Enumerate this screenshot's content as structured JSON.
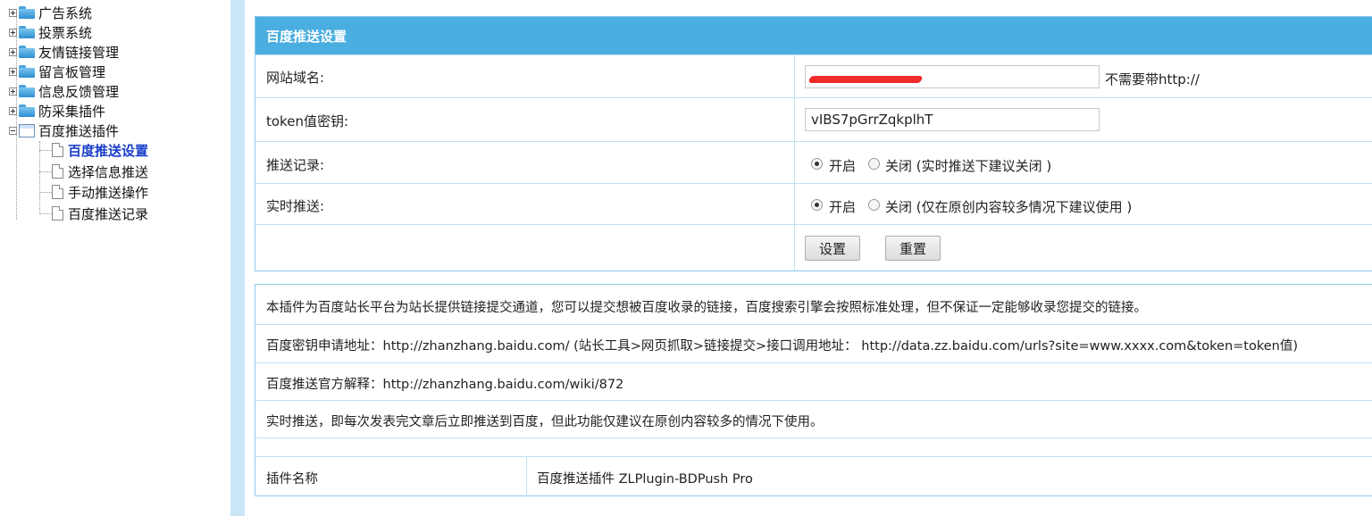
{
  "tree": {
    "nodes": [
      {
        "label": "广告系统"
      },
      {
        "label": "投票系统"
      },
      {
        "label": "友情链接管理"
      },
      {
        "label": "留言板管理"
      },
      {
        "label": "信息反馈管理"
      },
      {
        "label": "防采集插件"
      },
      {
        "label": "百度推送插件"
      }
    ],
    "children": [
      {
        "label": "百度推送设置",
        "active": true
      },
      {
        "label": "选择信息推送"
      },
      {
        "label": "手动推送操作"
      },
      {
        "label": "百度推送记录"
      }
    ]
  },
  "settings": {
    "title": "百度推送设置",
    "domain_label": "网站域名:",
    "domain_value": "",
    "domain_hint": "不需要带http://",
    "token_label": "token值密钥:",
    "token_value": "vIBS7pGrrZqkplhT",
    "record_label": "推送记录:",
    "record_on": "开启",
    "record_off": "关闭 (实时推送下建议关闭 )",
    "realtime_label": "实时推送:",
    "realtime_on": "开启",
    "realtime_off": "关闭 (仅在原创内容较多情况下建议使用 )",
    "submit_label": "设置",
    "reset_label": "重置"
  },
  "info": {
    "line1": "本插件为百度站长平台为站长提供链接提交通道，您可以提交想被百度收录的链接，百度搜索引擎会按照标准处理，但不保证一定能够收录您提交的链接。",
    "line2": "百度密钥申请地址：http://zhanzhang.baidu.com/ (站长工具>网页抓取>链接提交>接口调用地址： http://data.zz.baidu.com/urls?site=www.xxxx.com&token=token值)",
    "line3": "百度推送官方解释：http://zhanzhang.baidu.com/wiki/872",
    "line4": "实时推送，即每次发表完文章后立即推送到百度，但此功能仅建议在原创内容较多的情况下使用。",
    "plugin_name_label": "插件名称",
    "plugin_name_value": "百度推送插件 ZLPlugin-BDPush Pro"
  }
}
